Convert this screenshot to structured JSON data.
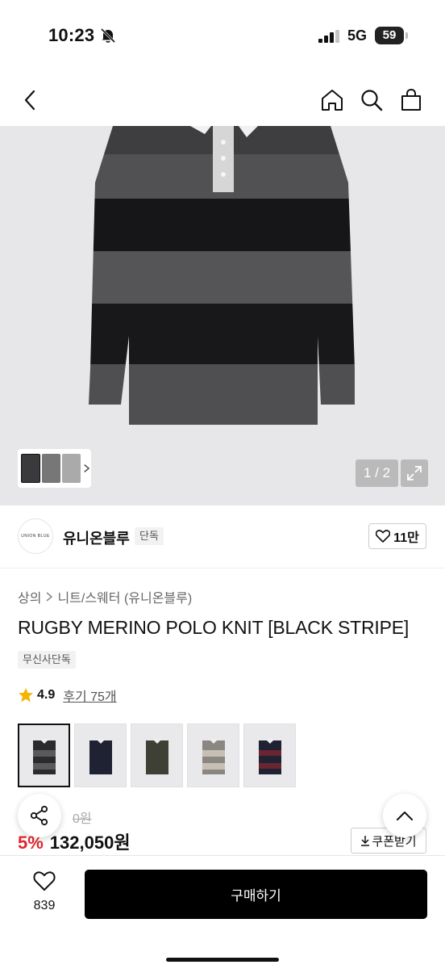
{
  "status": {
    "time": "10:23",
    "network": "5G",
    "battery": "59"
  },
  "nav": {
    "back_icon": "chevron-left-icon",
    "home_icon": "home-icon",
    "search_icon": "search-icon",
    "cart_icon": "bag-icon"
  },
  "hero": {
    "counter": "1 / 2"
  },
  "brand": {
    "logo_text": "UNION BLUE",
    "name": "유니온블루",
    "tag": "단독",
    "likes": "11만"
  },
  "breadcrumb": {
    "category": "상의",
    "subcategory": "니트/스웨터 (유니온블루)"
  },
  "product": {
    "title": "RUGBY MERINO POLO KNIT [BLACK STRIPE]",
    "badge": "무신사단독",
    "rating": "4.9",
    "review": "후기 75개"
  },
  "colors": [
    "black-stripe",
    "navy",
    "khaki",
    "grey-beige",
    "burgundy-stripe"
  ],
  "price": {
    "original_visible": "0원",
    "discount": "5%",
    "sale": "132,050원",
    "coupon_label": "쿠폰받기"
  },
  "bottom": {
    "wish_count": "839",
    "buy_label": "구매하기"
  }
}
